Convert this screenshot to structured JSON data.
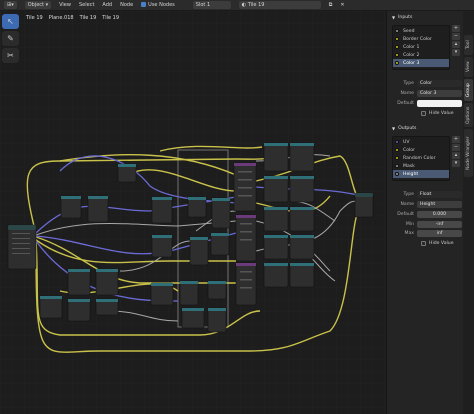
{
  "topbar": {
    "mode": "Object",
    "menus": [
      "View",
      "Select",
      "Add",
      "Node"
    ],
    "use_nodes": "Use Nodes",
    "slot": "Slot 1",
    "material": "Tile 19"
  },
  "breadcrumb": [
    "Tile 19",
    "Plane.018",
    "Tile 19",
    "Tile 19"
  ],
  "colors": {
    "accent": "#3d6bb3",
    "wire_yellow": "#c9c24a",
    "wire_purple": "#6b6bd6",
    "wire_grey": "#a0a0a0",
    "header_teal": "#2f6f78"
  },
  "inputs": {
    "title": "Inputs",
    "items": [
      {
        "label": "Seed",
        "color": "#a1a1a1"
      },
      {
        "label": "Border Color",
        "color": "#c7c729"
      },
      {
        "label": "Color 1",
        "color": "#c7c729"
      },
      {
        "label": "Color 2",
        "color": "#c7c729"
      },
      {
        "label": "Color 3",
        "color": "#c7c729"
      }
    ],
    "type_label": "Type",
    "type_value": "Color",
    "name_label": "Name",
    "name_value": "Color 3",
    "default_label": "Default",
    "hide_value": "Hide Value"
  },
  "outputs": {
    "title": "Outputs",
    "items": [
      {
        "label": "UV",
        "color": "#6363c7"
      },
      {
        "label": "Color",
        "color": "#c7c729"
      },
      {
        "label": "Random Color",
        "color": "#c7c729"
      },
      {
        "label": "Mask",
        "color": "#a1a1a1"
      },
      {
        "label": "Height",
        "color": "#a1a1a1"
      }
    ],
    "type_label": "Type",
    "type_value": "Float",
    "name_label": "Name",
    "name_value": "Height",
    "default_label": "Default",
    "default_value": "0.000",
    "min_label": "Min",
    "min_value": "-inf",
    "max_label": "Max",
    "max_value": "inf",
    "hide_value": "Hide Value"
  },
  "vtabs": [
    "Tool",
    "View",
    "Group",
    "Options",
    "Node Wrangler"
  ]
}
